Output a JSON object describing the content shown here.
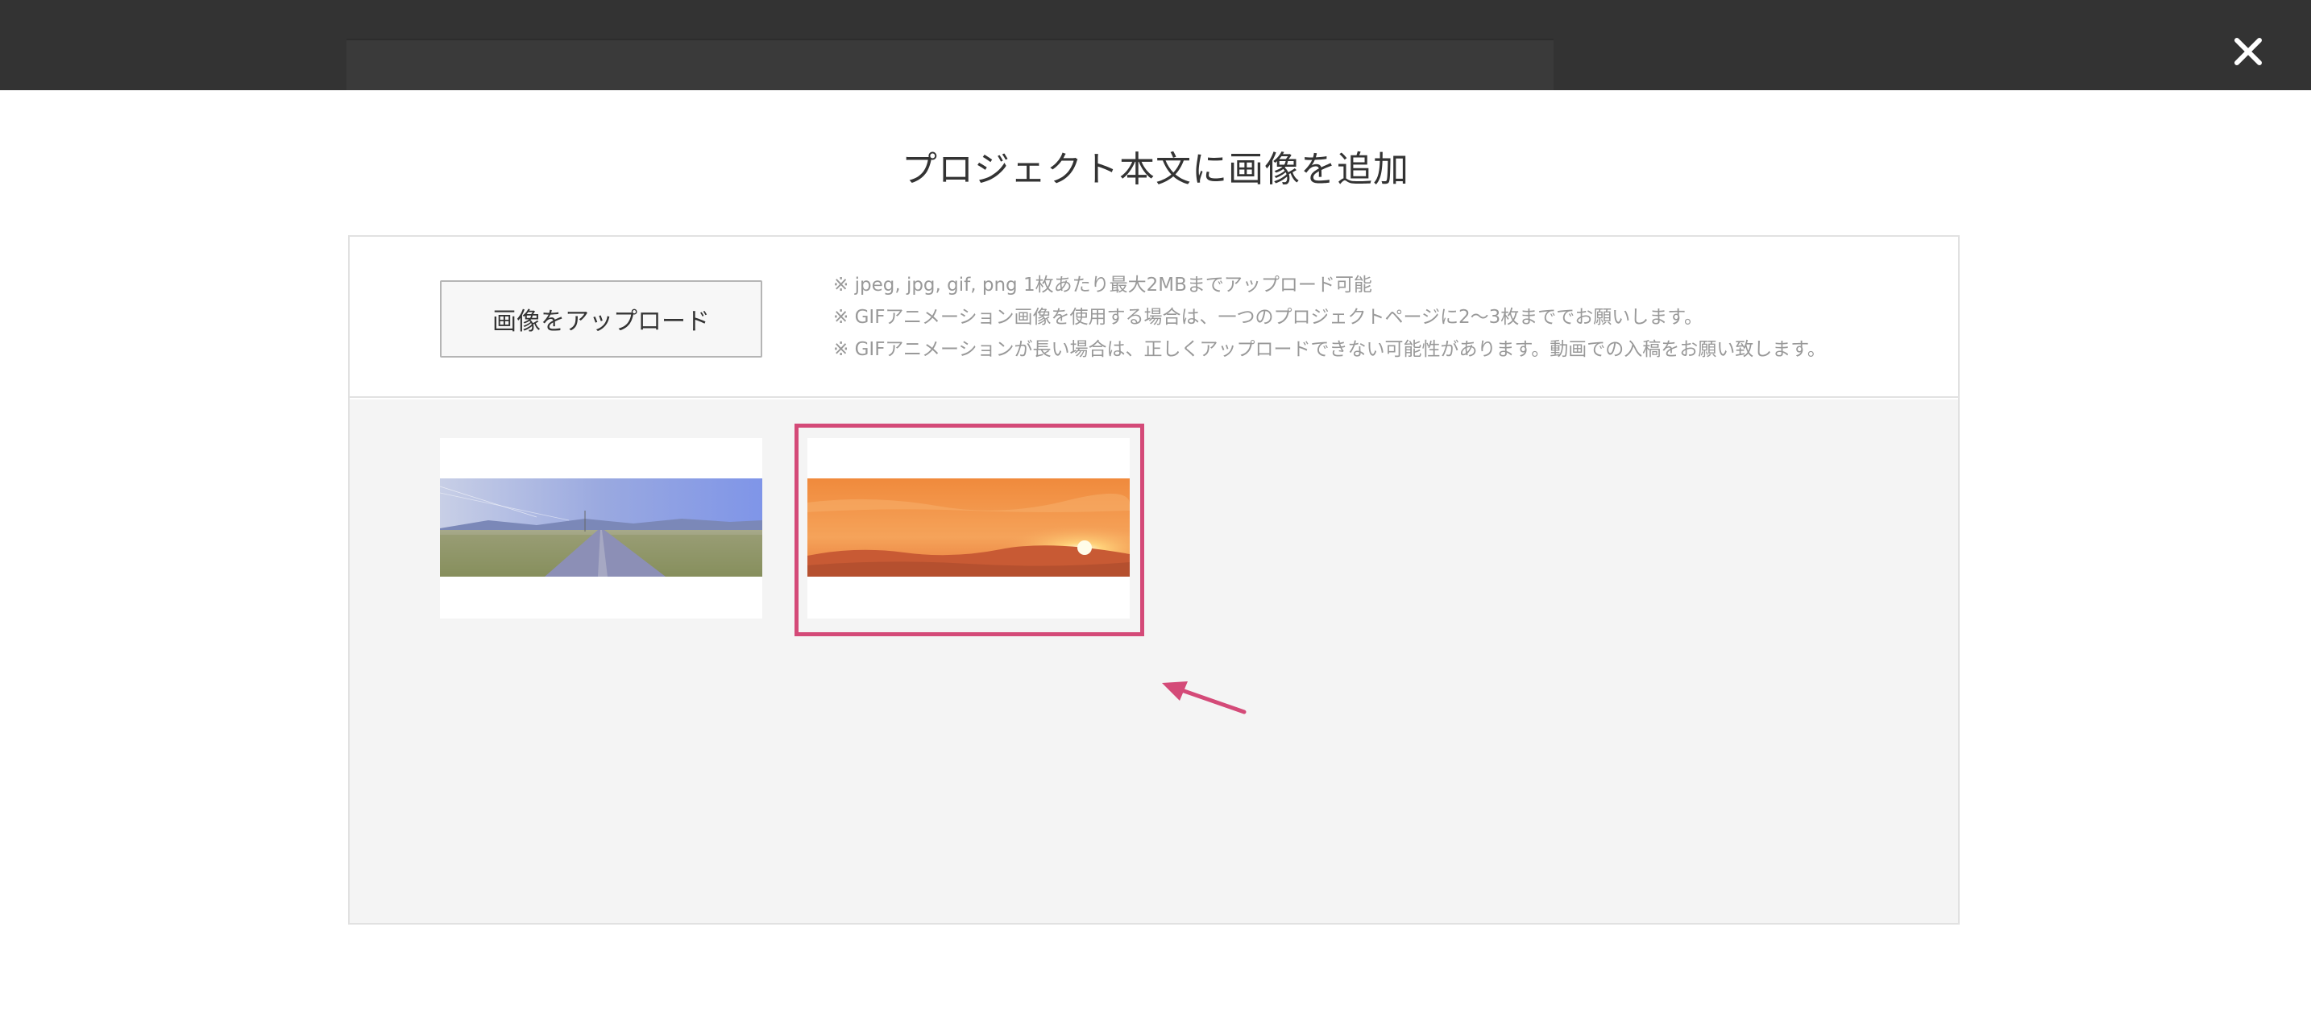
{
  "header": {
    "close_icon": "close-icon"
  },
  "modal": {
    "title": "プロジェクト本文に画像を追加",
    "upload_button_label": "画像をアップロード",
    "notes": [
      "※ jpeg, jpg, gif, png 1枚あたり最大2MBまでアップロード可能",
      "※ GIFアニメーション画像を使用する場合は、一つのプロジェクトページに2〜3枚まででお願いします。",
      "※ GIFアニメーションが長い場合は、正しくアップロードできない可能性があります。動画での入稿をお願い致します。"
    ]
  },
  "gallery": {
    "images": [
      {
        "subject": "road-landscape",
        "selected": false
      },
      {
        "subject": "sunset-sky",
        "selected": true
      }
    ]
  },
  "colors": {
    "topbar": "#333333",
    "highlight": "#d44a78",
    "gallery_bg": "#f4f4f4",
    "note_text": "#999999"
  }
}
